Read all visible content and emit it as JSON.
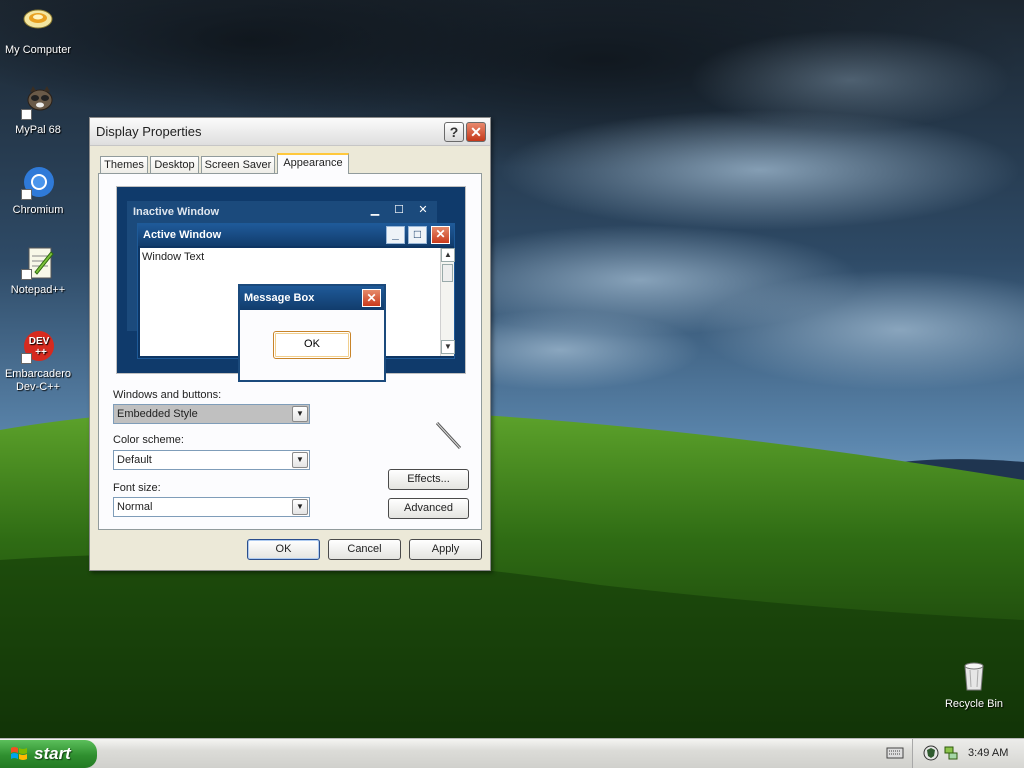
{
  "desktop": {
    "icons": [
      {
        "label": "My Computer",
        "icon": "my-computer-icon"
      },
      {
        "label": "MyPal 68",
        "icon": "mypal-browser-icon"
      },
      {
        "label": "Chromium",
        "icon": "chromium-icon"
      },
      {
        "label": "Notepad++",
        "icon": "notepad-plus-plus-icon"
      },
      {
        "label": "Embarcadero Dev-C++",
        "icon": "dev-cpp-icon"
      },
      {
        "label": "Recycle Bin",
        "icon": "recycle-bin-icon"
      }
    ],
    "devcpp_badge": "DEV\n++"
  },
  "dialog": {
    "title": "Display Properties",
    "help_glyph": "?",
    "close_glyph": "✕",
    "tabs": [
      {
        "label": "Themes",
        "active": false
      },
      {
        "label": "Desktop",
        "active": false
      },
      {
        "label": "Screen Saver",
        "active": false
      },
      {
        "label": "Appearance",
        "active": true
      }
    ],
    "preview": {
      "inactive_title": "Inactive Window",
      "active_title": "Active Window",
      "window_text": "Window Text",
      "message_box_title": "Message Box",
      "message_ok": "OK"
    },
    "windows_buttons": {
      "label": "Windows and buttons:",
      "value": "Embedded Style"
    },
    "color_scheme": {
      "label": "Color scheme:",
      "value": "Default"
    },
    "font_size": {
      "label": "Font size:",
      "value": "Normal"
    },
    "effects_button": "Effects...",
    "advanced_button": "Advanced",
    "ok_button": "OK",
    "cancel_button": "Cancel",
    "apply_button": "Apply"
  },
  "taskbar": {
    "start_label": "start",
    "clock": "3:49 AM"
  },
  "colors": {
    "titlebar_active": "#1f5a99",
    "start_green": "#2f8f2f",
    "tab_highlight": "#ffc83c"
  }
}
